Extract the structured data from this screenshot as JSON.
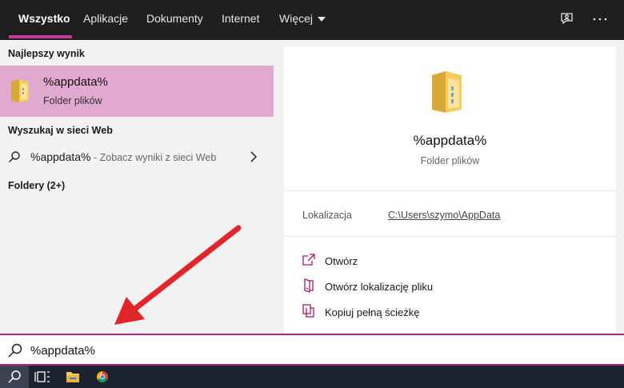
{
  "tabs": {
    "all": "Wszystko",
    "apps": "Aplikacje",
    "documents": "Dokumenty",
    "internet": "Internet",
    "more": "Więcej"
  },
  "left": {
    "best_match_heading": "Najlepszy wynik",
    "best_match": {
      "title": "%appdata%",
      "subtitle": "Folder plików",
      "icon": "folder-icon"
    },
    "web_heading": "Wyszukaj w sieci Web",
    "web_result": {
      "query": "%appdata%",
      "hint": " - Zobacz wyniki z sieci Web"
    },
    "folders_heading": "Foldery (2+)"
  },
  "preview": {
    "title": "%appdata%",
    "subtitle": "Folder plików",
    "location_label": "Lokalizacja",
    "location_value": "C:\\Users\\szymo\\AppData",
    "actions": [
      {
        "label": "Otwórz",
        "icon": "open-icon"
      },
      {
        "label": "Otwórz lokalizację pliku",
        "icon": "file-location-icon"
      },
      {
        "label": "Kopiuj pełną ścieżkę",
        "icon": "copy-path-icon"
      }
    ]
  },
  "search": {
    "value": "%appdata%"
  },
  "colors": {
    "accent": "#b3237f",
    "selected_row": "#e2a9d0",
    "topbar": "#1f1f1f",
    "taskbar": "#1b2230",
    "arrow": "#e0262b"
  }
}
